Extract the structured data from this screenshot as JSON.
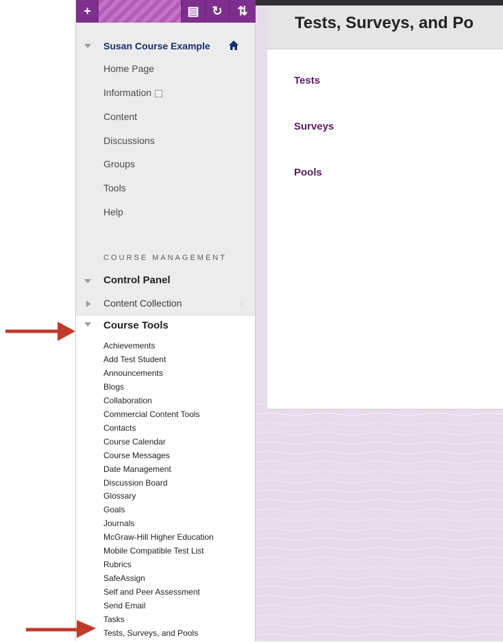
{
  "toolbar": {
    "add_glyph": "+",
    "btn1_glyph": "▤",
    "btn2_glyph": "↻",
    "btn3_glyph": "⇅"
  },
  "course_menu": {
    "title": "Susan Course Example",
    "items": [
      {
        "label": "Home Page"
      },
      {
        "label": "Information"
      },
      {
        "label": "Content"
      },
      {
        "label": "Discussions"
      },
      {
        "label": "Groups"
      },
      {
        "label": "Tools"
      },
      {
        "label": "Help"
      }
    ]
  },
  "course_management": {
    "heading": "COURSE MANAGEMENT",
    "control_panel": "Control Panel",
    "content_collection": "Content Collection",
    "content_collection_arrow": "→",
    "course_tools": "Course Tools",
    "tools": [
      "Achievements",
      "Add Test Student",
      "Announcements",
      "Blogs",
      "Collaboration",
      "Commercial Content Tools",
      "Contacts",
      "Course Calendar",
      "Course Messages",
      "Date Management",
      "Discussion Board",
      "Glossary",
      "Goals",
      "Journals",
      "McGraw-Hill Higher Education",
      "Mobile Compatible Test List",
      "Rubrics",
      "SafeAssign",
      "Self and Peer Assessment",
      "Send Email",
      "Tasks",
      "Tests, Surveys, and Pools"
    ]
  },
  "content": {
    "page_title": "Tests, Surveys, and Po",
    "links": [
      "Tests",
      "Surveys",
      "Pools"
    ]
  },
  "colors": {
    "accent_purple": "#8c3f98",
    "link_purple": "#5b1a62",
    "annotation_red": "#c0392b"
  }
}
